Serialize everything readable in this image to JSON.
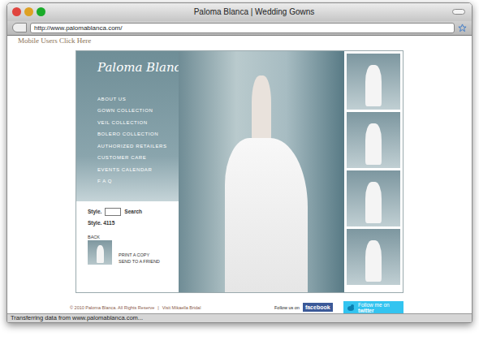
{
  "window": {
    "title": "Paloma Blanca | Wedding Gowns"
  },
  "address_bar": {
    "url": "http://www.palomablanca.com/"
  },
  "page": {
    "mobile_link": "Mobile Users Click Here",
    "logo": "Paloma Blanca",
    "menu": [
      {
        "label": "ABOUT US"
      },
      {
        "label": "GOWN COLLECTION"
      },
      {
        "label": "VEIL COLLECTION"
      },
      {
        "label": "BOLERO COLLECTION"
      },
      {
        "label": "AUTHORIZED RETAILERS"
      },
      {
        "label": "CUSTOMER CARE"
      },
      {
        "label": "EVENTS CALENDAR"
      },
      {
        "label": "F A Q"
      }
    ],
    "style_search": {
      "label": "Style.",
      "button": "Search"
    },
    "style_number": "Style. 4115",
    "back": "BACK",
    "actions": [
      "PRINT A COPY",
      "SEND TO A FRIEND"
    ]
  },
  "footer": {
    "copyright": "© 2010 Paloma Blanca. All Rights Reserve",
    "separator": "|",
    "link": "Visit Mikaella Bridal",
    "follow_label": "Follow us on",
    "facebook": "facebook",
    "twitter_line1": "Follow me on",
    "twitter_line2": "twitter"
  },
  "status_bar": "Transferring data from www.palomablanca.com..."
}
